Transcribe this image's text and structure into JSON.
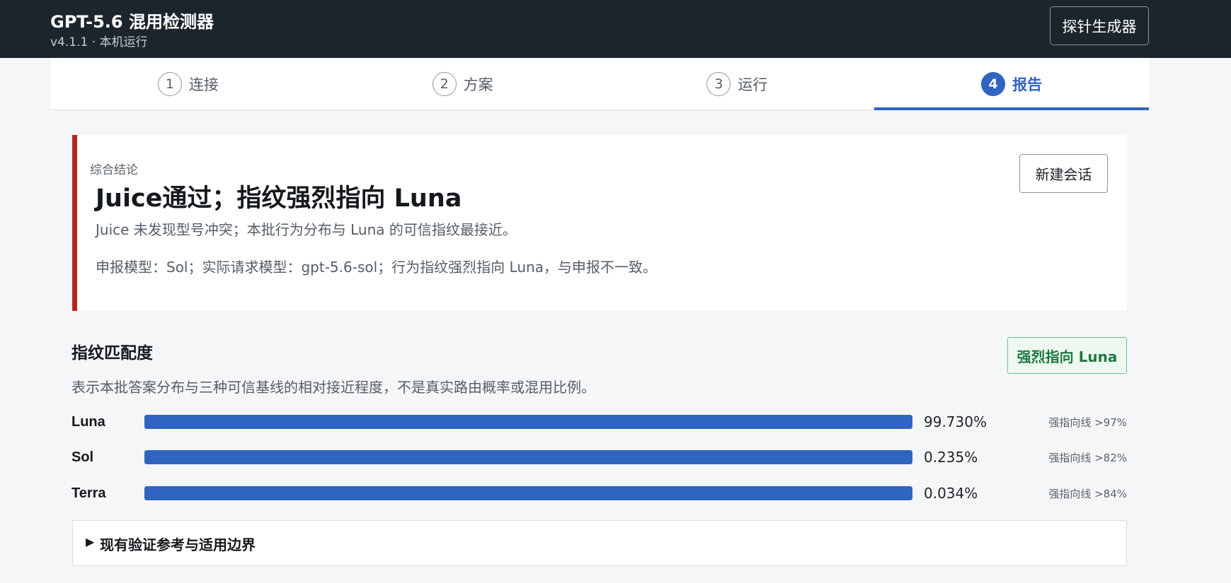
{
  "header": {
    "title": "GPT-5.6 混用检测器",
    "subtitle": "v4.1.1 · 本机运行",
    "probe_button": "探针生成器"
  },
  "steps": [
    {
      "num": "1",
      "label": "连接"
    },
    {
      "num": "2",
      "label": "方案"
    },
    {
      "num": "3",
      "label": "运行"
    },
    {
      "num": "4",
      "label": "报告",
      "active": true
    }
  ],
  "verdict": {
    "kicker": "综合结论",
    "title": "Juice通过；指纹强烈指向 Luna",
    "summary": "Juice 未发现型号冲突；本批行为分布与 Luna 的可信指纹最接近。",
    "detail": "申报模型：Sol；实际请求模型：gpt-5.6-sol；行为指纹强烈指向 Luna，与申报不一致。",
    "accent_color": "#b4261f",
    "new_session_button": "新建会话"
  },
  "fingerprint": {
    "title": "指纹匹配度",
    "description": "表示本批答案分布与三种可信基线的相对接近程度，不是真实路由概率或混用比例。",
    "badge": "强烈指向 Luna",
    "bar_color": "#2f65c0",
    "rows": [
      {
        "name": "Luna",
        "percent": "99.730%",
        "threshold": "强指向线 >97%",
        "fill": 1.0
      },
      {
        "name": "Sol",
        "percent": "0.235%",
        "threshold": "强指向线 >82%",
        "fill": 1.0
      },
      {
        "name": "Terra",
        "percent": "0.034%",
        "threshold": "强指向线 >84%",
        "fill": 1.0
      }
    ]
  },
  "details": {
    "caret": "▶",
    "label": "现有验证参考与适用边界"
  }
}
